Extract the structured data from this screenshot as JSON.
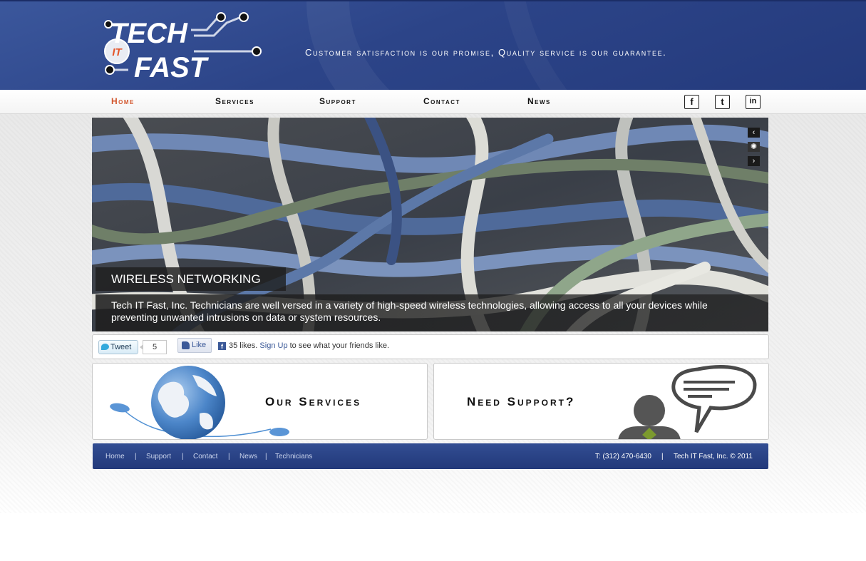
{
  "brand": {
    "logo_line1": "TECH",
    "logo_badge": "IT",
    "logo_line2": "FAST",
    "tagline": "Customer satisfaction is our promise, Quality service is our guarantee."
  },
  "nav": {
    "items": [
      "Home",
      "Services",
      "Support",
      "Contact",
      "News"
    ],
    "active": "Home",
    "social": [
      {
        "icon": "facebook-icon",
        "glyph": "f"
      },
      {
        "icon": "twitter-icon",
        "glyph": "t"
      },
      {
        "icon": "linkedin-icon",
        "glyph": "in"
      }
    ]
  },
  "slider": {
    "title": "WIRELESS NETWORKING",
    "caption": "Tech IT Fast, Inc. Technicians are well versed in a variety of high-speed wireless technologies, allowing access to all your devices while preventing unwanted intrusions on data or system resources.",
    "prev_glyph": "‹",
    "next_glyph": "›",
    "loading_glyph": "✺"
  },
  "share": {
    "tweet_label": "Tweet",
    "tweet_count": "5",
    "like_label": "Like",
    "likes_text": "35 likes.",
    "signup_label": "Sign Up",
    "likes_suffix": "to see what your friends like."
  },
  "panels": {
    "services_label": "Our Services",
    "support_label": "Need Support?"
  },
  "footer": {
    "links": [
      "Home",
      "Support",
      "Contact",
      "News",
      "Technicians"
    ],
    "separator": "|",
    "phone": "T: (312) 470-6430",
    "copyright": "Tech IT Fast, Inc. © 2011"
  },
  "colors": {
    "header_blue": "#2c4488",
    "accent_orange": "#d2552c"
  }
}
